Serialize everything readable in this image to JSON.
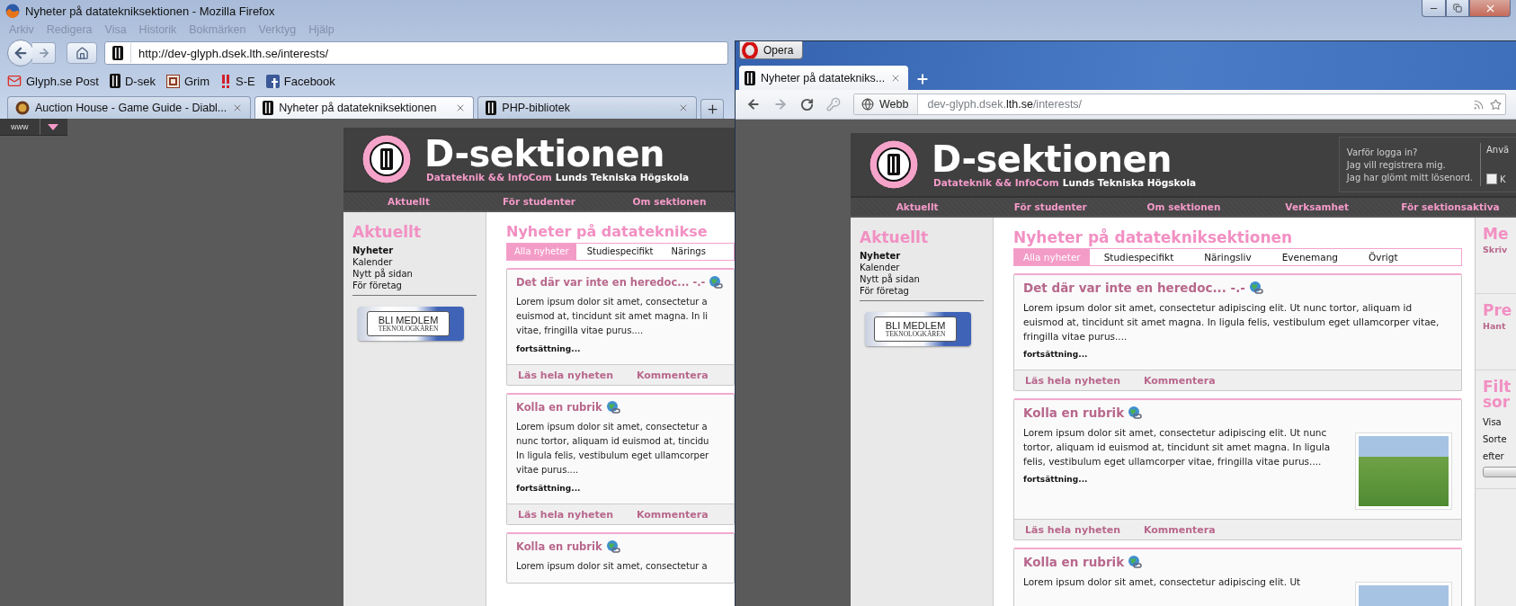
{
  "firefox": {
    "title": "Nyheter på datatekniksektionen - Mozilla Firefox",
    "menu": [
      "Arkiv",
      "Redigera",
      "Visa",
      "Historik",
      "Bokmärken",
      "Verktyg",
      "Hjälp"
    ],
    "url": "http://dev-glyph.dsek.lth.se/interests/",
    "bookmarks": [
      {
        "label": "Glyph.se Post",
        "kind": "mail"
      },
      {
        "label": "D-sek",
        "kind": "pillar"
      },
      {
        "label": "Grim",
        "kind": "framed"
      },
      {
        "label": "S-E",
        "kind": "marks"
      },
      {
        "label": "Facebook",
        "kind": "social"
      }
    ],
    "tabs": [
      {
        "label": "Auction House - Game Guide - Diabl...",
        "selected": false,
        "kind": "round"
      },
      {
        "label": "Nyheter på datatekniksektionen",
        "selected": true,
        "kind": "pillar"
      },
      {
        "label": "PHP-bibliotek",
        "selected": false,
        "kind": "pillar"
      }
    ],
    "addon_bar": {
      "label": "www"
    },
    "page": {
      "site_title": "D-sektionen",
      "subtitle": "Datateknik && InfoCom",
      "school": "Lunds Tekniska Högskola",
      "nav": [
        "Aktuellt",
        "För studenter",
        "Om sektionen"
      ],
      "sidebar": {
        "heading": "Aktuellt",
        "items": [
          {
            "label": "Nyheter",
            "selected": true
          },
          {
            "label": "Kalender",
            "selected": false
          },
          {
            "label": "Nytt på sidan",
            "selected": false
          },
          {
            "label": "För företag",
            "selected": false
          }
        ],
        "banner": {
          "title": "BLI MEDLEM",
          "subtitle": "TEKNOLOGKÅREN"
        }
      },
      "heading": "Nyheter på datateknikse",
      "tabs": [
        {
          "label": "Alla nyheter",
          "selected": true
        },
        {
          "label": "Studiespecifikt",
          "selected": false
        },
        {
          "label": "Närings",
          "selected": false
        }
      ],
      "cards": [
        {
          "title": "Det där var inte en heredoc... -.-",
          "lines": [
            "Lorem ipsum dolor sit amet, consectetur a",
            "euismod at, tincidunt sit amet magna. In li",
            "vitae, fringilla vitae purus...."
          ],
          "more": "fortsättning...",
          "links": [
            "Läs hela nyheten",
            "Kommentera"
          ]
        },
        {
          "title": "Kolla en rubrik",
          "lines": [
            "Lorem ipsum dolor sit amet, consectetur a",
            "nunc tortor, aliquam id euismod at, tincidu",
            "In ligula felis, vestibulum eget ullamcorper",
            "vitae purus...."
          ],
          "more": "fortsättning...",
          "links": [
            "Läs hela nyheten",
            "Kommentera"
          ]
        },
        {
          "title": "Kolla en rubrik",
          "lines": [
            "Lorem ipsum dolor sit amet, consectetur a"
          ]
        }
      ]
    }
  },
  "opera": {
    "menu_button": "Opera",
    "tabs": [
      {
        "label": "Nyheter på datatekniks...",
        "selected": true
      }
    ],
    "address": {
      "scope": "Webb",
      "url": "dev-glyph.dsek.**lth.se**/interests/"
    },
    "page": {
      "site_title": "D-sektionen",
      "subtitle": "Datateknik && InfoCom",
      "school": "Lunds Tekniska Högskola",
      "login": {
        "links": [
          "Varför logga in?",
          "Jag vill registrera mig.",
          "Jag har glömt mitt lösenord."
        ],
        "field_label": "Anvä",
        "remember": {
          "label": "K",
          "checked": false
        }
      },
      "nav": [
        "Aktuellt",
        "För studenter",
        "Om sektionen",
        "Verksamhet",
        "För sektionsaktiva"
      ],
      "sidebar": {
        "heading": "Aktuellt",
        "items": [
          {
            "label": "Nyheter",
            "selected": true
          },
          {
            "label": "Kalender",
            "selected": false
          },
          {
            "label": "Nytt på sidan",
            "selected": false
          },
          {
            "label": "För företag",
            "selected": false
          }
        ],
        "banner": {
          "title": "BLI MEDLEM",
          "subtitle": "TEKNOLOGKÅREN"
        }
      },
      "heading": "Nyheter på datatekniksektionen",
      "tabs": [
        {
          "label": "Alla nyheter",
          "selected": true
        },
        {
          "label": "Studiespecifikt",
          "selected": false
        },
        {
          "label": "Näringsliv",
          "selected": false
        },
        {
          "label": "Evenemang",
          "selected": false
        },
        {
          "label": "Övrigt",
          "selected": false
        }
      ],
      "cards": [
        {
          "title": "Det där var inte en heredoc... -.-",
          "text": "Lorem ipsum dolor sit amet, consectetur adipiscing elit. Ut nunc tortor, aliquam id euismod at, tincidunt sit amet magna. In ligula felis, vestibulum eget ullamcorper vitae, fringilla vitae purus....",
          "more": "fortsättning...",
          "links": [
            "Läs hela nyheten",
            "Kommentera"
          ],
          "photo": false
        },
        {
          "title": "Kolla en rubrik",
          "text": "Lorem ipsum dolor sit amet, consectetur adipiscing elit. Ut nunc tortor, aliquam id euismod at, tincidunt sit amet magna. In ligula felis, vestibulum eget ullamcorper vitae, fringilla vitae purus....",
          "more": "fortsättning...",
          "links": [
            "Läs hela nyheten",
            "Kommentera"
          ],
          "photo": true
        },
        {
          "title": "Kolla en rubrik",
          "text": "Lorem ipsum dolor sit amet, consectetur adipiscing elit. Ut",
          "photo": true
        }
      ],
      "right_column": [
        {
          "heading_lines": [
            "Me"
          ],
          "items": [
            {
              "kind": "link",
              "label": "Skriv"
            }
          ]
        },
        {
          "heading_lines": [
            "Pre"
          ],
          "items": [
            {
              "kind": "link",
              "label": "Hant"
            }
          ]
        },
        {
          "heading_lines": [
            "Filt",
            "sor"
          ],
          "items": [
            {
              "kind": "label",
              "label": "Visa"
            },
            {
              "kind": "label",
              "label": "Sorte"
            },
            {
              "kind": "label",
              "label": "efter"
            },
            {
              "kind": "button"
            }
          ]
        }
      ]
    }
  }
}
